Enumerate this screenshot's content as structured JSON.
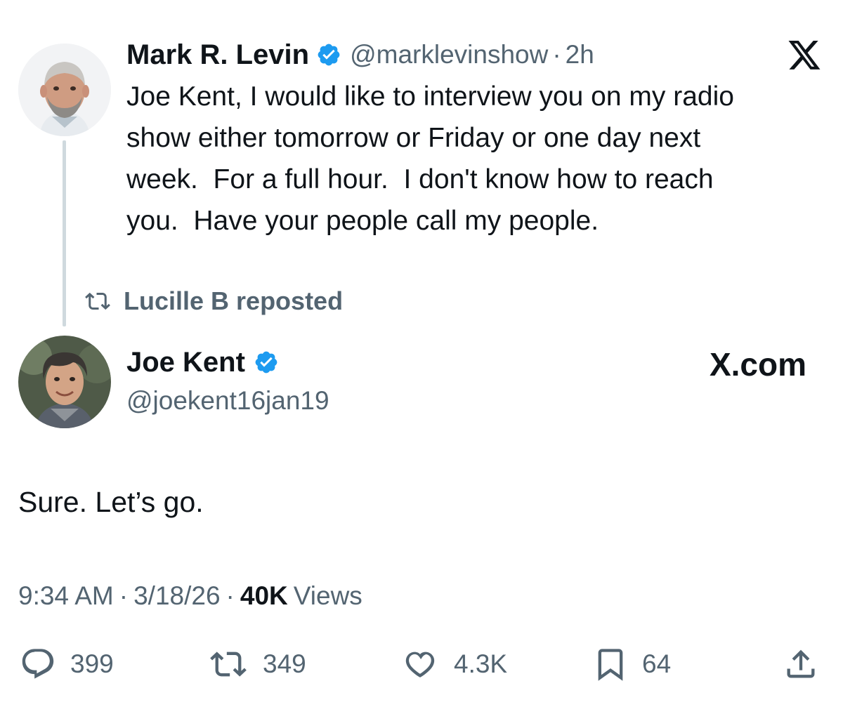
{
  "quoted_tweet": {
    "author_name": "Mark R. Levin",
    "handle": "@marklevinshow",
    "separator": "·",
    "time": "2h",
    "lines": [
      "Joe Kent, I would like to interview you on my radio",
      "show either tomorrow or Friday or one day next",
      "week.  For a full hour.  I don't know how to reach",
      "you.  Have your people call my people."
    ]
  },
  "repost": {
    "label": "Lucille B reposted",
    "icon": "repost-icon"
  },
  "main_tweet": {
    "author_name": "Joe Kent",
    "handle": "@joekent16jan19",
    "brand": "X.com",
    "text": "Sure. Let’s go.",
    "meta": {
      "time": "9:34 AM",
      "sep1": "·",
      "date": "3/18/26",
      "sep2": "·",
      "views_count": "40K",
      "views_label": "Views"
    },
    "actions": {
      "replies": "399",
      "reposts": "349",
      "likes": "4.3K",
      "bookmarks": "64"
    }
  },
  "colors": {
    "verified": "#1d9bf0",
    "text": "#0f1419",
    "muted": "#536471",
    "thread_line": "#cfd9de"
  }
}
